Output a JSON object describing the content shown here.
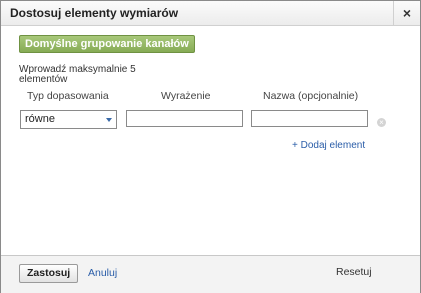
{
  "dialog": {
    "title": "Dostosuj elementy wymiarów",
    "close_symbol": "×"
  },
  "default_grouping_button": "Domyślne grupowanie kanałów",
  "max_note": "Wprowadź maksymalnie 5 elementów",
  "columns": {
    "match_type": "Typ dopasowania",
    "expression": "Wyrażenie",
    "name": "Nazwa (opcjonalnie)"
  },
  "row": {
    "match_type_value": "równe",
    "expression_value": "",
    "name_value": ""
  },
  "remove_symbol": "×",
  "add_element_link": "+ Dodaj element",
  "footer": {
    "apply": "Zastosuj",
    "cancel": "Anuluj",
    "reset": "Resetuj"
  },
  "icons": {
    "close": "close-icon",
    "dropdown": "chevron-down-icon",
    "remove": "remove-circle-icon"
  },
  "colors": {
    "primary_green": "#86ab55",
    "link_blue": "#2a5da8"
  }
}
